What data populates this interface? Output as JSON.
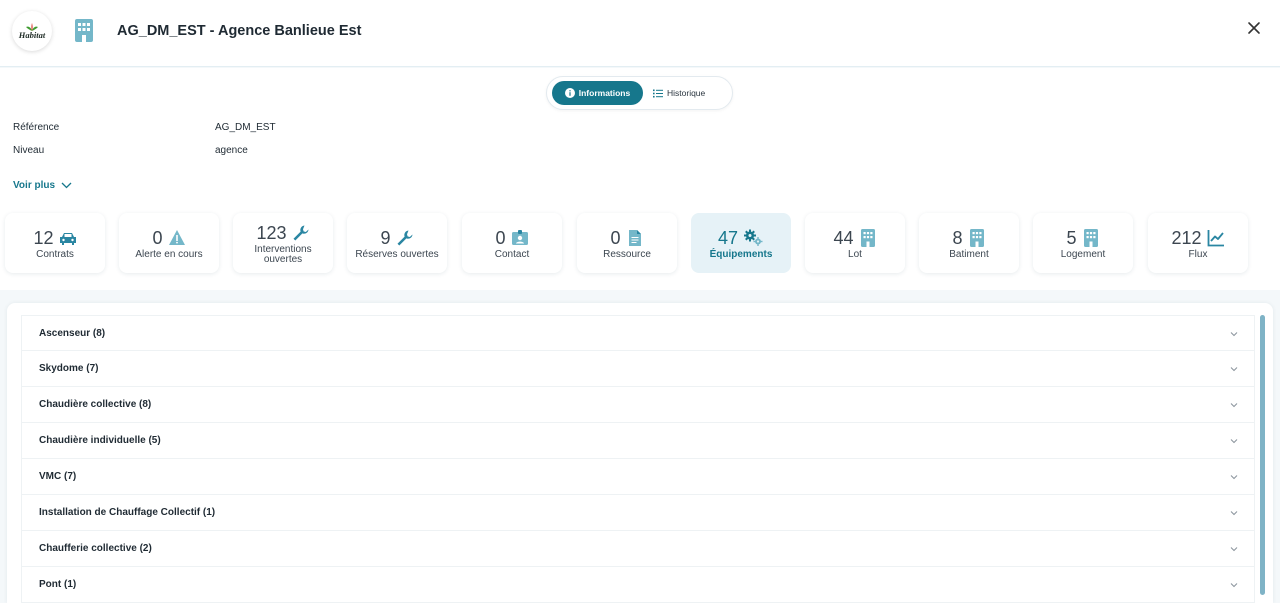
{
  "header": {
    "logo_text": "Habitat",
    "title": "AG_DM_EST - Agence Banlieue Est",
    "close_icon": "close-icon"
  },
  "tabs": [
    {
      "label": "Informations",
      "icon": "info-circle-icon",
      "active": true
    },
    {
      "label": "Historique",
      "icon": "list-icon",
      "active": false
    }
  ],
  "fields": [
    {
      "label": "Référence",
      "value": "AG_DM_EST"
    },
    {
      "label": "Niveau",
      "value": "agence"
    }
  ],
  "voir_plus": "Voir plus",
  "stats": [
    {
      "value": "12",
      "label": "Contrats",
      "icon": "car-icon"
    },
    {
      "value": "0",
      "label": "Alerte en cours",
      "icon": "warning-icon"
    },
    {
      "value": "123",
      "label": "Interventions ouvertes",
      "icon": "wrench-icon"
    },
    {
      "value": "9",
      "label": "Réserves ouvertes",
      "icon": "wrench-icon"
    },
    {
      "value": "0",
      "label": "Contact",
      "icon": "contact-card-icon"
    },
    {
      "value": "0",
      "label": "Ressource",
      "icon": "document-icon"
    },
    {
      "value": "47",
      "label": "Équipements",
      "icon": "gears-icon",
      "active": true
    },
    {
      "value": "44",
      "label": "Lot",
      "icon": "building-icon"
    },
    {
      "value": "8",
      "label": "Batiment",
      "icon": "building-icon"
    },
    {
      "value": "5",
      "label": "Logement",
      "icon": "building-icon"
    },
    {
      "value": "212",
      "label": "Flux",
      "icon": "line-chart-icon"
    }
  ],
  "equipment_groups": [
    "Ascenseur (8)",
    "Skydome (7)",
    "Chaudière collective (8)",
    "Chaudière individuelle (5)",
    "VMC (7)",
    "Installation de Chauffage Collectif (1)",
    "Chaufferie collective (2)",
    "Pont (1)"
  ],
  "colors": {
    "accent": "#16778c",
    "icon_blue": "#2a86a2",
    "icon_light": "#74b7c9",
    "active_card_bg": "#e6f2f7",
    "page_bg": "#f4f8fa"
  }
}
